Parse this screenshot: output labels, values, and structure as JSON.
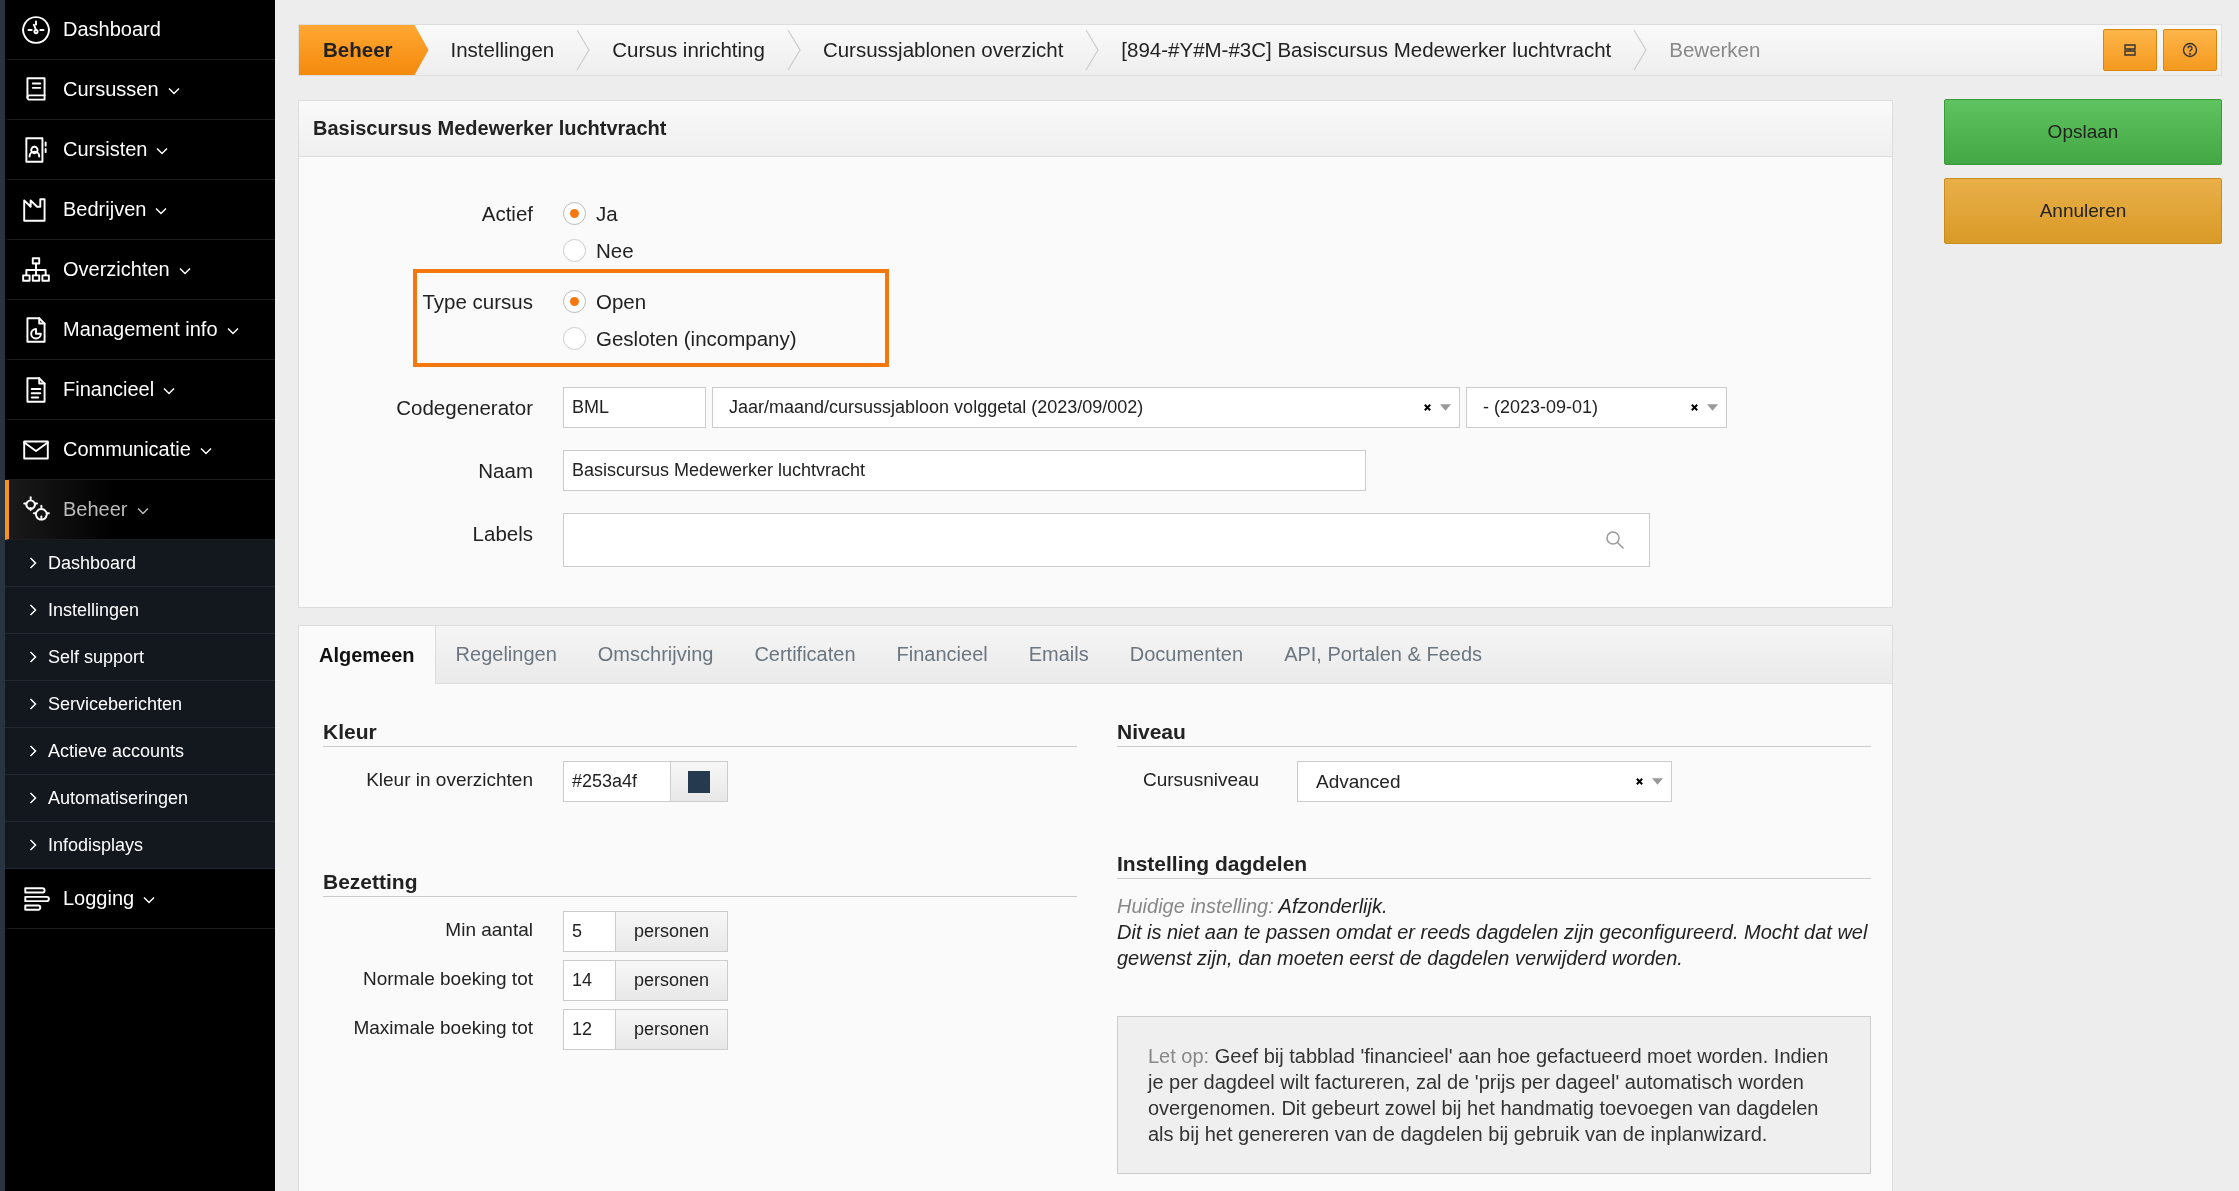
{
  "sidebar": {
    "items": [
      {
        "label": "Dashboard",
        "expandable": false,
        "selected": false
      },
      {
        "label": "Cursussen",
        "expandable": true,
        "selected": false
      },
      {
        "label": "Cursisten",
        "expandable": true,
        "selected": false
      },
      {
        "label": "Bedrijven",
        "expandable": true,
        "selected": false
      },
      {
        "label": "Overzichten",
        "expandable": true,
        "selected": false
      },
      {
        "label": "Management info",
        "expandable": true,
        "selected": false
      },
      {
        "label": "Financieel",
        "expandable": true,
        "selected": false
      },
      {
        "label": "Communicatie",
        "expandable": true,
        "selected": false
      },
      {
        "label": "Beheer",
        "expandable": true,
        "selected": true,
        "children": [
          {
            "label": "Dashboard"
          },
          {
            "label": "Instellingen"
          },
          {
            "label": "Self support"
          },
          {
            "label": "Serviceberichten"
          },
          {
            "label": "Actieve accounts"
          },
          {
            "label": "Automatiseringen"
          },
          {
            "label": "Infodisplays"
          }
        ]
      },
      {
        "label": "Logging",
        "expandable": true,
        "selected": false
      }
    ]
  },
  "breadcrumb": [
    {
      "label": "Beheer",
      "kind": "module"
    },
    {
      "label": "Instellingen",
      "kind": "link"
    },
    {
      "label": "Cursus inrichting",
      "kind": "link"
    },
    {
      "label": "Cursussjablonen overzicht",
      "kind": "link"
    },
    {
      "label": "[894-#Y#M-#3C] Basiscursus Medewerker luchtvracht",
      "kind": "link"
    },
    {
      "label": "Bewerken",
      "kind": "current"
    }
  ],
  "actions": [
    {
      "label": "Opslaan",
      "kind": "primary"
    },
    {
      "label": "Annuleren",
      "kind": "warning"
    }
  ],
  "form": {
    "title": "Basiscursus Medewerker luchtvracht",
    "fields": [
      {
        "kind": "radio",
        "label": "Actief",
        "highlighted": false,
        "options": [
          {
            "label": "Ja",
            "selected": true
          },
          {
            "label": "Nee",
            "selected": false
          }
        ]
      },
      {
        "kind": "radio",
        "label": "Type cursus",
        "highlighted": true,
        "options": [
          {
            "label": "Open",
            "selected": true
          },
          {
            "label": "Gesloten (incompany)",
            "selected": false
          }
        ]
      },
      {
        "kind": "code",
        "label": "Codegenerator",
        "prefix": "BML",
        "format": "Jaar/maand/cursussjabloon volggetal (2023/09/002)",
        "date": "- (2023-09-01)"
      },
      {
        "kind": "text",
        "label": "Naam",
        "value": "Basiscursus Medewerker luchtvracht"
      },
      {
        "kind": "search",
        "label": "Labels"
      }
    ]
  },
  "tabs": [
    {
      "label": "Algemeen",
      "selected": true
    },
    {
      "label": "Regelingen",
      "selected": false
    },
    {
      "label": "Omschrijving",
      "selected": false
    },
    {
      "label": "Certificaten",
      "selected": false
    },
    {
      "label": "Financieel",
      "selected": false
    },
    {
      "label": "Emails",
      "selected": false
    },
    {
      "label": "Documenten",
      "selected": false
    },
    {
      "label": "API, Portalen & Feeds",
      "selected": false
    }
  ],
  "colour": {
    "heading": "Kleur",
    "label": "Kleur in overzichten",
    "value": "#253a4f"
  },
  "occupancy": {
    "heading": "Bezetting",
    "rows": [
      {
        "label": "Min aantal",
        "value": "5",
        "unit": "personen"
      },
      {
        "label": "Normale boeking tot",
        "value": "14",
        "unit": "personen"
      },
      {
        "label": "Maximale boeking tot",
        "value": "12",
        "unit": "personen"
      }
    ]
  },
  "level": {
    "heading": "Niveau",
    "label": "Cursusniveau",
    "value": "Advanced"
  },
  "day_parts": {
    "heading": "Instelling dagdelen",
    "current_label": "Huidige instelling:",
    "current_value": "Afzonderlijk.",
    "note": "Dit is niet aan te passen omdat er reeds dagdelen zijn geconfigureerd. Mocht dat wel gewenst zijn, dan moeten eerst de dagdelen verwijderd worden.",
    "notice_lead": "Let op:",
    "notice": "Geef bij tabblad 'financieel' aan hoe gefactueerd moet worden. Indien je per dagdeel wilt factureren, zal de 'prijs per dageel' automatisch worden overgenomen. Dit gebeurt zowel bij het handmatig toevoegen van dagdelen als bij het genereren van de dagdelen bij gebruik van de inplanwizard."
  }
}
